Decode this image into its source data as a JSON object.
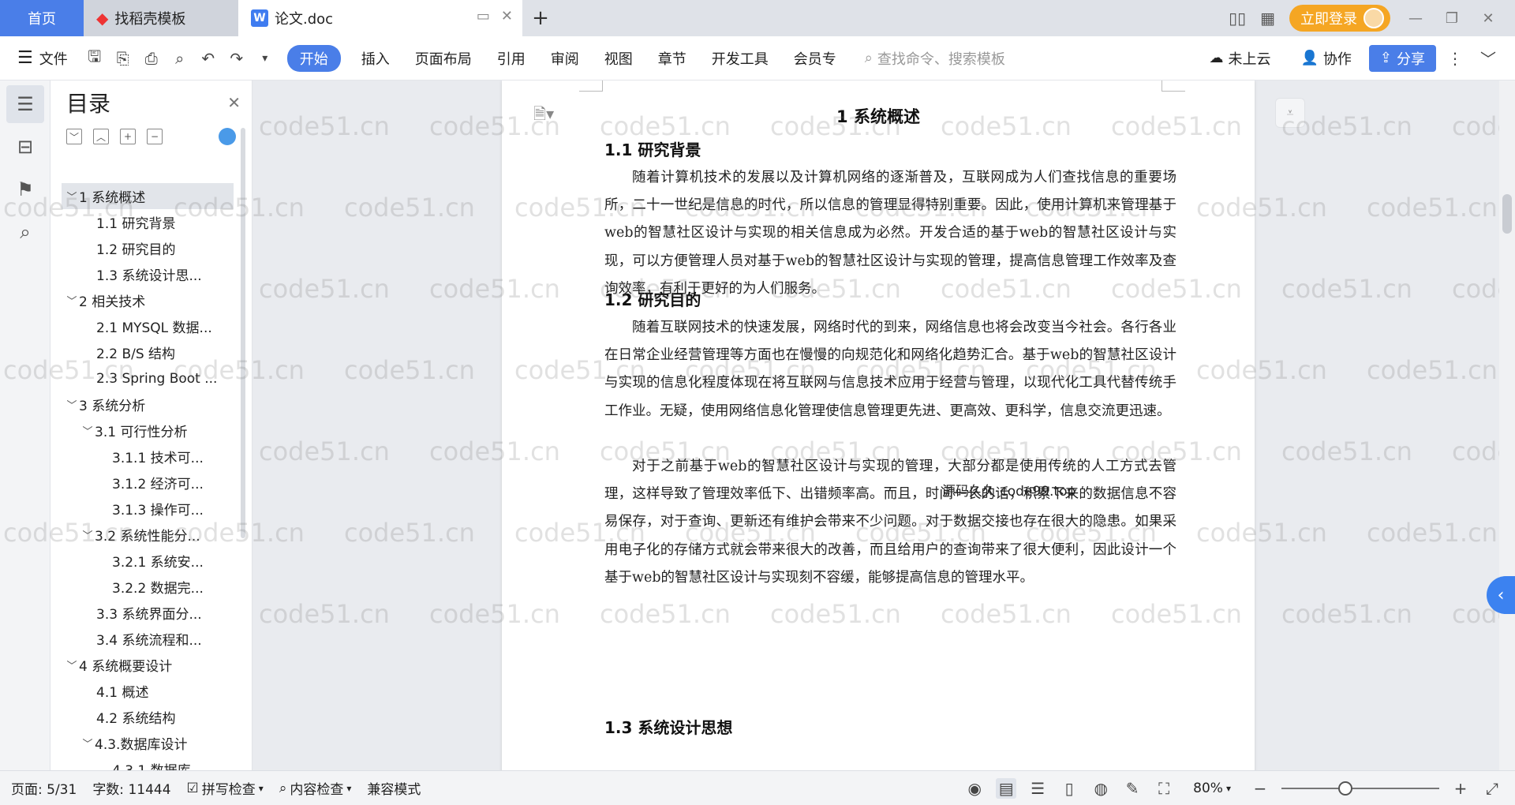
{
  "tabs": {
    "home": "首页",
    "daoke": "找稻壳模板",
    "doc": "论文.doc",
    "login": "立即登录"
  },
  "toolbar": {
    "file": "文件",
    "start": "开始",
    "insert": "插入",
    "layout": "页面布局",
    "reference": "引用",
    "review": "审阅",
    "view": "视图",
    "chapter": "章节",
    "devtools": "开发工具",
    "member": "会员专",
    "search_placeholder": "查找命令、搜索模板",
    "cloud": "未上云",
    "collab": "协作",
    "share": "分享"
  },
  "toc": {
    "title": "目录",
    "items": [
      {
        "label": "1 系统概述",
        "level": 0,
        "caret": "﹀",
        "active": true
      },
      {
        "label": "1.1  研究背景",
        "level": 1,
        "caret": ""
      },
      {
        "label": "1.2 研究目的",
        "level": 1,
        "caret": ""
      },
      {
        "label": "1.3 系统设计思...",
        "level": 1,
        "caret": ""
      },
      {
        "label": "2 相关技术",
        "level": 0,
        "caret": "﹀"
      },
      {
        "label": "2.1 MYSQL 数据...",
        "level": 1,
        "caret": ""
      },
      {
        "label": "2.2 B/S 结构",
        "level": 1,
        "caret": ""
      },
      {
        "label": "2.3 Spring Boot ...",
        "level": 1,
        "caret": ""
      },
      {
        "label": "3 系统分析",
        "level": 0,
        "caret": "﹀"
      },
      {
        "label": "3.1 可行性分析",
        "level": 1,
        "caret": "﹀"
      },
      {
        "label": "3.1.1 技术可...",
        "level": 2,
        "caret": ""
      },
      {
        "label": "3.1.2 经济可...",
        "level": 2,
        "caret": ""
      },
      {
        "label": "3.1.3 操作可...",
        "level": 2,
        "caret": ""
      },
      {
        "label": "3.2 系统性能分...",
        "level": 1,
        "caret": "﹀"
      },
      {
        "label": "3.2.1  系统安...",
        "level": 2,
        "caret": ""
      },
      {
        "label": "3.2.2  数据完...",
        "level": 2,
        "caret": ""
      },
      {
        "label": "3.3 系统界面分...",
        "level": 1,
        "caret": ""
      },
      {
        "label": "3.4 系统流程和...",
        "level": 1,
        "caret": ""
      },
      {
        "label": "4 系统概要设计",
        "level": 0,
        "caret": "﹀"
      },
      {
        "label": "4.1 概述",
        "level": 1,
        "caret": ""
      },
      {
        "label": "4.2 系统结构",
        "level": 1,
        "caret": ""
      },
      {
        "label": "4.3.数据库设计",
        "level": 1,
        "caret": "﹀"
      },
      {
        "label": "4.3.1 数据库...",
        "level": 2,
        "caret": ""
      }
    ]
  },
  "document": {
    "h1": "1 系统概述",
    "h2_1": "1.1  研究背景",
    "p1": "随着计算机技术的发展以及计算机网络的逐渐普及，互联网成为人们查找信息的重要场所，二十一世纪是信息的时代，所以信息的管理显得特别重要。因此，使用计算机来管理基于web的智慧社区设计与实现的相关信息成为必然。开发合适的基于web的智慧社区设计与实现，可以方便管理人员对基于web的智慧社区设计与实现的管理，提高信息管理工作效率及查询效率，有利于更好的为人们服务。",
    "h2_2": "1.2 研究目的",
    "p2": "随着互联网技术的快速发展，网络时代的到来，网络信息也将会改变当今社会。各行各业在日常企业经营管理等方面也在慢慢的向规范化和网络化趋势汇合。基于web的智慧社区设计与实现的信息化程度体现在将互联网与信息技术应用于经营与管理，以现代化工具代替传统手工作业。无疑，使用网络信息化管理使信息管理更先进、更高效、更科学，信息交流更迅速。",
    "p3": "对于之前基于web的智慧社区设计与实现的管理，大部分都是使用传统的人工方式去管理，这样导致了管理效率低下、出错频率高。而且，时间一长的话，积累下来的数据信息不容易保存，对于查询、更新还有维护会带来不少问题。对于数据交接也存在很大的隐患。如果采用电子化的存储方式就会带来很大的改善，而且给用户的查询带来了很大便利，因此设计一个基于web的智慧社区设计与实现刻不容缓，能够提高信息的管理水平。",
    "h2_3": "1.3 系统设计思想",
    "overlay": "源码久久 code99.top"
  },
  "watermark": "code51.cn",
  "status": {
    "page": "页面: 5/31",
    "words": "字数: 11444",
    "spell": "拼写检查",
    "content": "内容检查",
    "compat": "兼容模式",
    "zoom": "80%"
  }
}
